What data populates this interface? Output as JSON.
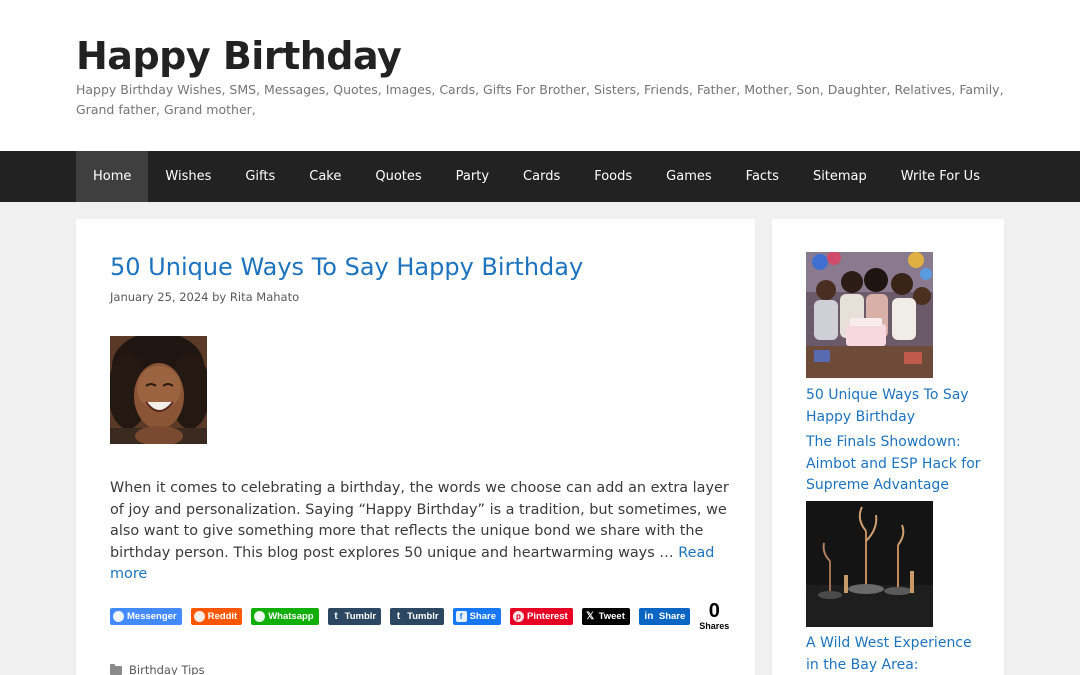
{
  "site": {
    "title": "Happy Birthday",
    "description": "Happy Birthday Wishes, SMS, Messages, Quotes, Images, Cards, Gifts For Brother, Sisters, Friends, Father, Mother, Son, Daughter, Relatives, Family, Grand father, Grand mother,"
  },
  "nav": {
    "items": [
      {
        "label": "Home"
      },
      {
        "label": "Wishes"
      },
      {
        "label": "Gifts"
      },
      {
        "label": "Cake"
      },
      {
        "label": "Quotes"
      },
      {
        "label": "Party"
      },
      {
        "label": "Cards"
      },
      {
        "label": "Foods"
      },
      {
        "label": "Games"
      },
      {
        "label": "Facts"
      },
      {
        "label": "Sitemap"
      },
      {
        "label": "Write For Us"
      }
    ]
  },
  "post": {
    "title": "50 Unique Ways To Say Happy Birthday",
    "date": "January 25, 2024",
    "by": "by",
    "author": "Rita Mahato",
    "excerpt": "When it comes to celebrating a birthday, the words we choose can add an extra layer of joy and personalization. Saying “Happy Birthday” is a tradition, but sometimes, we also want to give something more that reflects the unique bond we share with the birthday person. This blog post explores 50 unique and heartwarming ways … ",
    "read_more": "Read more",
    "category": "Birthday Tips"
  },
  "share": {
    "buttons": [
      {
        "label": "Messenger",
        "icon": "messenger-icon",
        "color": "#448aff"
      },
      {
        "label": "Reddit",
        "icon": "reddit-icon",
        "color": "#ff5700"
      },
      {
        "label": "Whatsapp",
        "icon": "whatsapp-icon",
        "color": "#12af0a"
      },
      {
        "label": "Tumblr",
        "icon": "tumblr-icon",
        "color": "#2c4762"
      },
      {
        "label": "Tumblr",
        "icon": "tumblr-icon",
        "color": "#2c4762"
      },
      {
        "label": "Share",
        "icon": "facebook-icon",
        "color": "#1877f2"
      },
      {
        "label": "Pinterest",
        "icon": "pinterest-icon",
        "color": "#e60023"
      },
      {
        "label": "Tweet",
        "icon": "x-icon",
        "color": "#000000"
      },
      {
        "label": "Share",
        "icon": "linkedin-icon",
        "color": "#0a66c2"
      }
    ],
    "count": "0",
    "count_label": "Shares"
  },
  "sidebar": {
    "links": [
      {
        "title": "50 Unique Ways To Say Happy Birthday"
      },
      {
        "title": "The Finals Showdown: Aimbot and ESP Hack for Supreme Advantage"
      },
      {
        "title": "A Wild West Experience in the Bay Area:"
      }
    ]
  },
  "colors": {
    "link": "#1e73be",
    "nav_bg": "#222222",
    "nav_active": "#3f3f3f",
    "page_bg": "#f0f0f0"
  }
}
